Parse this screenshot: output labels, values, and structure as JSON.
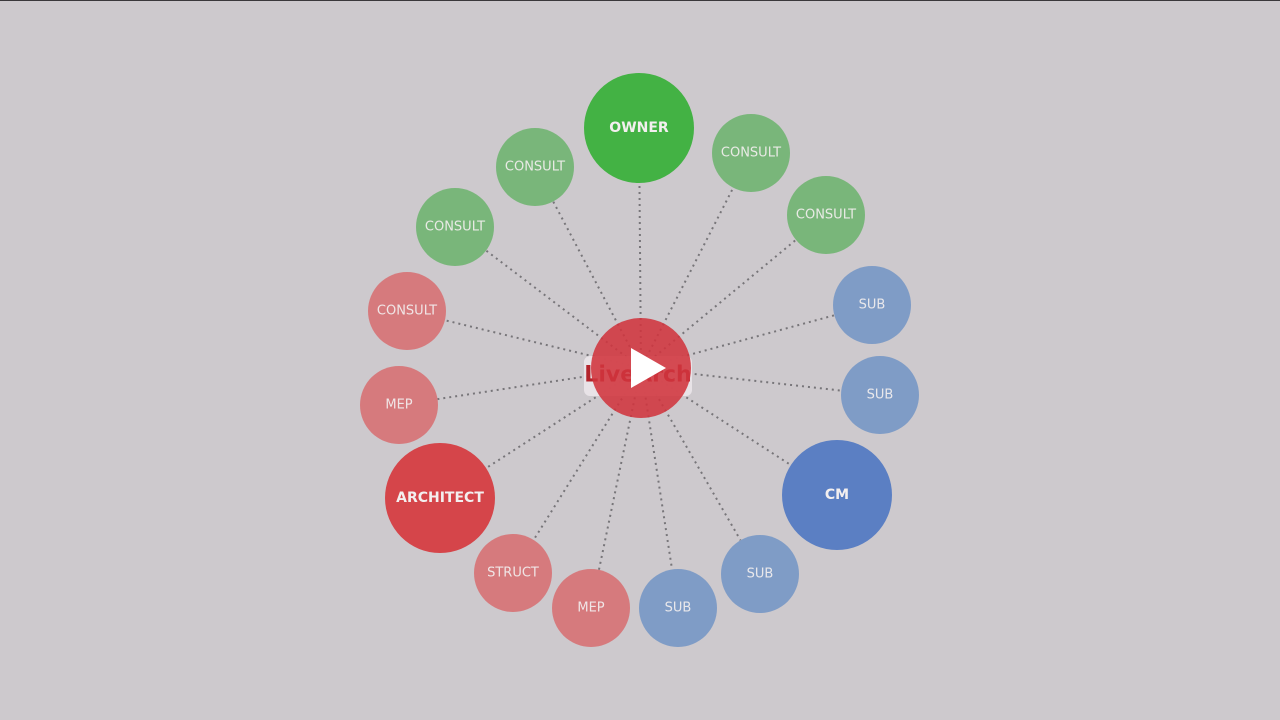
{
  "player": {
    "logo_text": "LiveArch",
    "play_button": "play-icon"
  },
  "colors": {
    "background": "#cdc9cd",
    "green_major": "#43b244",
    "green_minor": "#79b67a",
    "red_major": "#d5454a",
    "red_minor": "#d67a7d",
    "blue_major": "#5b7fc3",
    "blue_minor": "#7f9cc6",
    "center": "#d0343d"
  },
  "diagram": {
    "center": {
      "label": "LiveArch"
    },
    "nodes": [
      {
        "id": "owner",
        "label": "OWNER",
        "group": "green",
        "major": true
      },
      {
        "id": "consult-green-right-1",
        "label": "CONSULT",
        "group": "green",
        "major": false
      },
      {
        "id": "consult-green-right-2",
        "label": "CONSULT",
        "group": "green",
        "major": false
      },
      {
        "id": "sub-1",
        "label": "SUB",
        "group": "blue",
        "major": false
      },
      {
        "id": "sub-2",
        "label": "SUB",
        "group": "blue",
        "major": false
      },
      {
        "id": "cm",
        "label": "CM",
        "group": "blue",
        "major": true
      },
      {
        "id": "sub-3",
        "label": "SUB",
        "group": "blue",
        "major": false
      },
      {
        "id": "sub-4",
        "label": "SUB",
        "group": "blue",
        "major": false
      },
      {
        "id": "mep-bottom",
        "label": "MEP",
        "group": "red",
        "major": false
      },
      {
        "id": "struct",
        "label": "STRUCT",
        "group": "red",
        "major": false
      },
      {
        "id": "architect",
        "label": "ARCHITECT",
        "group": "red",
        "major": true
      },
      {
        "id": "mep-left",
        "label": "MEP",
        "group": "red",
        "major": false
      },
      {
        "id": "consult-red",
        "label": "CONSULT",
        "group": "red",
        "major": false
      },
      {
        "id": "consult-green-left-1",
        "label": "CONSULT",
        "group": "green",
        "major": false
      },
      {
        "id": "consult-green-left-2",
        "label": "CONSULT",
        "group": "green",
        "major": false
      }
    ]
  }
}
